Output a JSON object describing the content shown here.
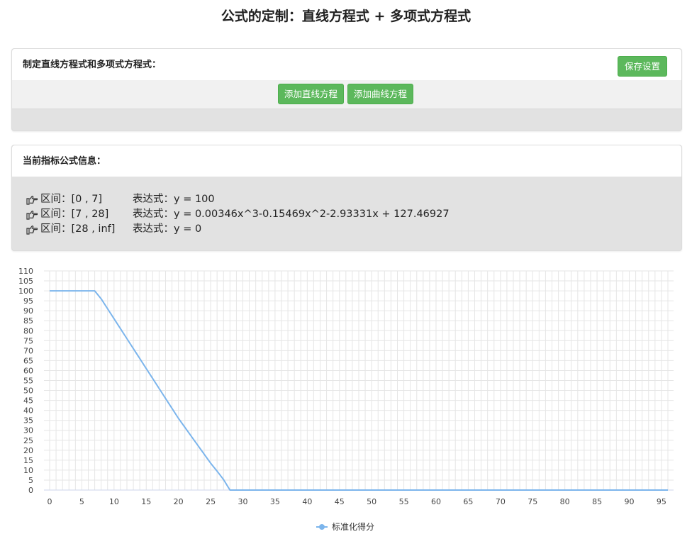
{
  "page": {
    "title": "公式的定制：直线方程式 + 多项式方程式"
  },
  "panel_define": {
    "heading": "制定直线方程式和多项式方程式：",
    "save_label": "保存设置",
    "add_line_label": "添加直线方程",
    "add_curve_label": "添加曲线方程"
  },
  "panel_current": {
    "heading": "当前指标公式信息：",
    "icon": "hand-point-right-icon",
    "items": [
      {
        "interval": "区间：[0 , 7]",
        "expression": "表达式：y = 100"
      },
      {
        "interval": "区间：[7 , 28]",
        "expression": "表达式：y = 0.00346x^3-0.15469x^2-2.93331x + 127.46927"
      },
      {
        "interval": "区间：[28 , inf]",
        "expression": "表达式：y = 0"
      }
    ]
  },
  "colors": {
    "accent_green": "#5cb85c",
    "line_blue": "#7cb5ec",
    "panel_gray": "#e2e2e2"
  },
  "chart_data": {
    "type": "line",
    "xlim": [
      0,
      96
    ],
    "ylim": [
      0,
      110
    ],
    "x_ticks": [
      0,
      5,
      10,
      15,
      20,
      25,
      30,
      35,
      40,
      45,
      50,
      55,
      60,
      65,
      70,
      75,
      80,
      85,
      90,
      95
    ],
    "y_ticks": [
      0,
      5,
      10,
      15,
      20,
      25,
      30,
      35,
      40,
      45,
      50,
      55,
      60,
      65,
      70,
      75,
      80,
      85,
      90,
      95,
      100,
      105,
      110
    ],
    "grid": true,
    "legend_position": "bottom-center",
    "series": [
      {
        "name": "标准化得分",
        "x": [
          0,
          7,
          8,
          9,
          10,
          11,
          12,
          13,
          14,
          15,
          16,
          17,
          18,
          19,
          20,
          21,
          22,
          23,
          24,
          25,
          26,
          27,
          28,
          29,
          96
        ],
        "y": [
          100,
          100,
          96,
          91,
          86,
          81,
          76,
          71,
          66,
          61,
          56,
          51,
          46,
          41,
          36,
          31.5,
          27,
          22.5,
          18,
          13.5,
          9.5,
          5.3,
          0,
          0,
          0
        ]
      }
    ]
  }
}
